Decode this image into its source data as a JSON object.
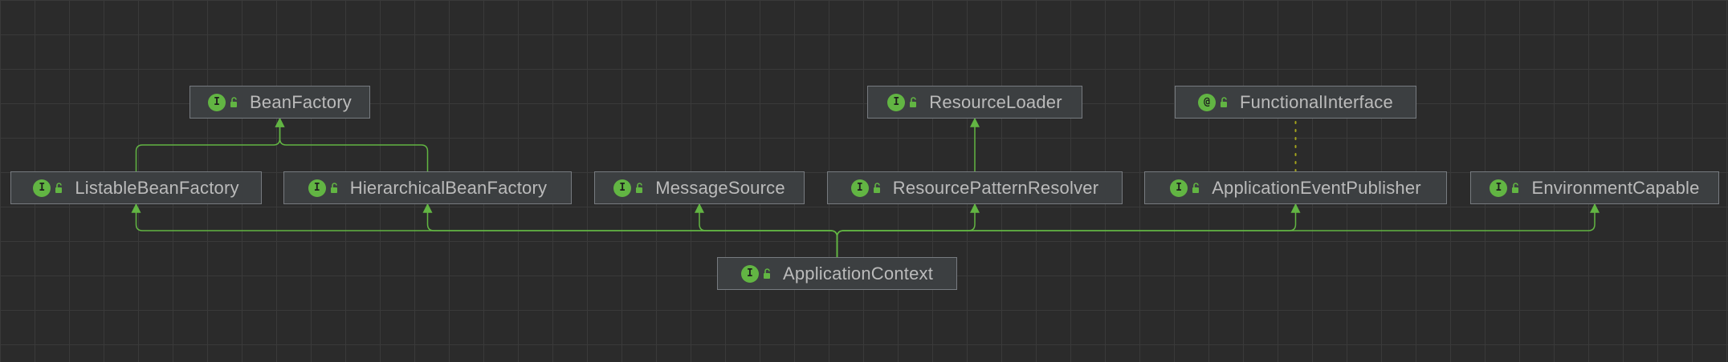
{
  "diagram": {
    "colors": {
      "background": "#2b2b2b",
      "grid": "#3a3a3a",
      "node_fill": "#3c3f41",
      "node_border": "#777b80",
      "text": "#bbbbbb",
      "icon": "#62b543",
      "extends_edge": "#62b543",
      "annotation_edge": "#a6a61c"
    },
    "nodes": [
      {
        "id": "BeanFactory",
        "label": "BeanFactory",
        "kind_icon": "I",
        "kind": "interface",
        "access_icon": "lock-open-icon"
      },
      {
        "id": "ResourceLoader",
        "label": "ResourceLoader",
        "kind_icon": "I",
        "kind": "interface",
        "access_icon": "lock-open-icon"
      },
      {
        "id": "FunctionalInterface",
        "label": "FunctionalInterface",
        "kind_icon": "@",
        "kind": "annotation",
        "access_icon": "lock-open-icon"
      },
      {
        "id": "ListableBeanFactory",
        "label": "ListableBeanFactory",
        "kind_icon": "I",
        "kind": "interface",
        "access_icon": "lock-open-icon"
      },
      {
        "id": "HierarchicalBeanFactory",
        "label": "HierarchicalBeanFactory",
        "kind_icon": "I",
        "kind": "interface",
        "access_icon": "lock-open-icon"
      },
      {
        "id": "MessageSource",
        "label": "MessageSource",
        "kind_icon": "I",
        "kind": "interface",
        "access_icon": "lock-open-icon"
      },
      {
        "id": "ResourcePatternResolver",
        "label": "ResourcePatternResolver",
        "kind_icon": "I",
        "kind": "interface",
        "access_icon": "lock-open-icon"
      },
      {
        "id": "ApplicationEventPublisher",
        "label": "ApplicationEventPublisher",
        "kind_icon": "I",
        "kind": "interface",
        "access_icon": "lock-open-icon"
      },
      {
        "id": "EnvironmentCapable",
        "label": "EnvironmentCapable",
        "kind_icon": "I",
        "kind": "interface",
        "access_icon": "lock-open-icon"
      },
      {
        "id": "ApplicationContext",
        "label": "ApplicationContext",
        "kind_icon": "I",
        "kind": "interface",
        "access_icon": "lock-open-icon"
      }
    ],
    "edges": [
      {
        "from": "ListableBeanFactory",
        "to": "BeanFactory",
        "type": "extends"
      },
      {
        "from": "HierarchicalBeanFactory",
        "to": "BeanFactory",
        "type": "extends"
      },
      {
        "from": "ResourcePatternResolver",
        "to": "ResourceLoader",
        "type": "extends"
      },
      {
        "from": "ApplicationEventPublisher",
        "to": "FunctionalInterface",
        "type": "annotated"
      },
      {
        "from": "ApplicationContext",
        "to": "ListableBeanFactory",
        "type": "extends"
      },
      {
        "from": "ApplicationContext",
        "to": "HierarchicalBeanFactory",
        "type": "extends"
      },
      {
        "from": "ApplicationContext",
        "to": "MessageSource",
        "type": "extends"
      },
      {
        "from": "ApplicationContext",
        "to": "ResourcePatternResolver",
        "type": "extends"
      },
      {
        "from": "ApplicationContext",
        "to": "ApplicationEventPublisher",
        "type": "extends"
      },
      {
        "from": "ApplicationContext",
        "to": "EnvironmentCapable",
        "type": "extends"
      }
    ]
  }
}
